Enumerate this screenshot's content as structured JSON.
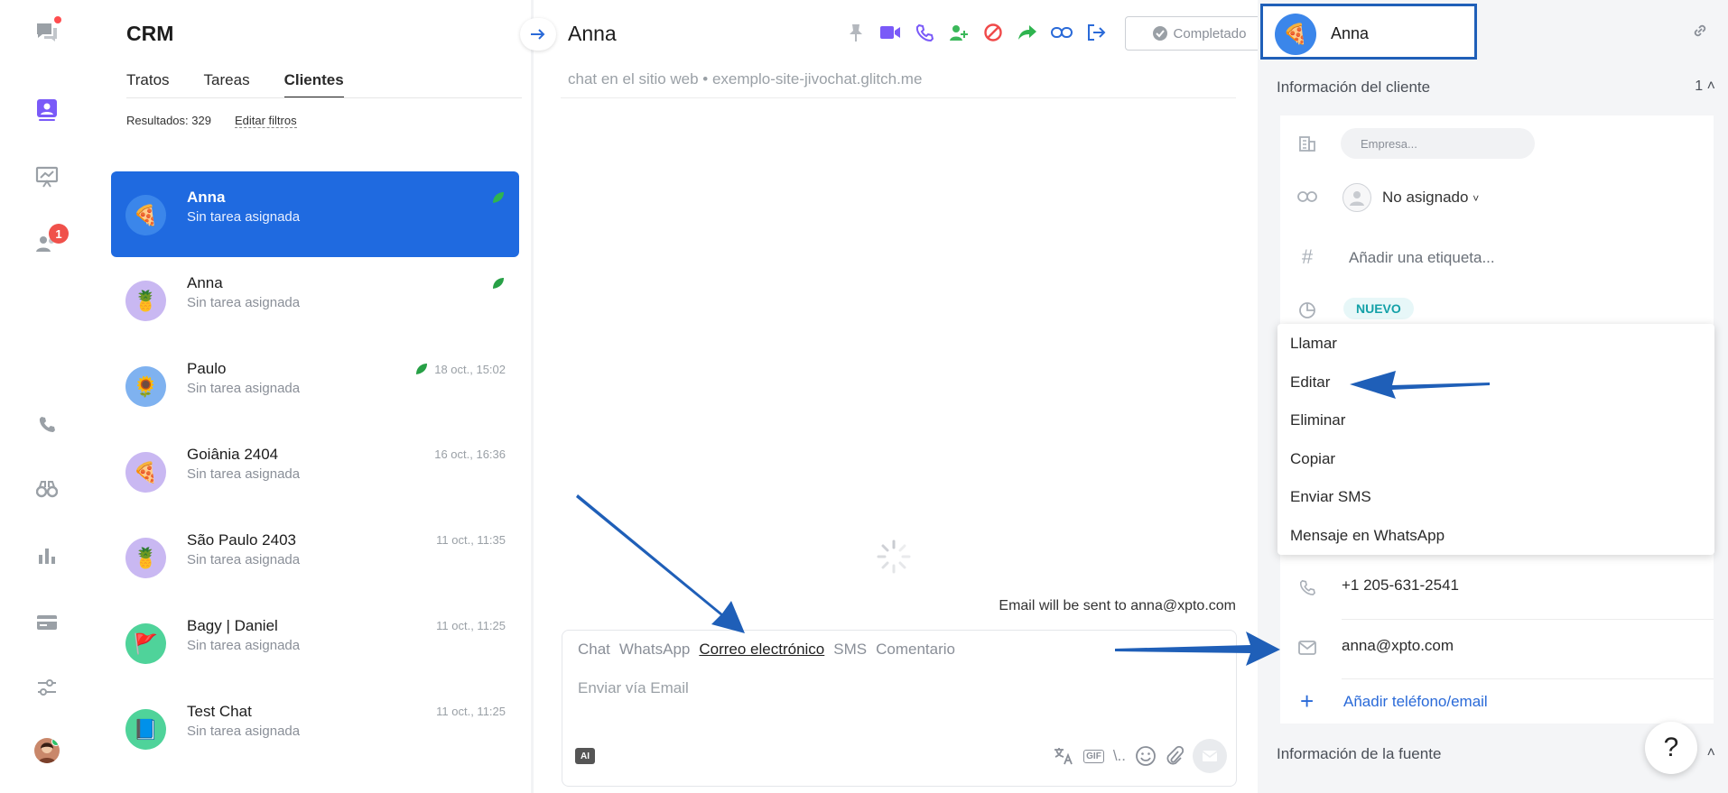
{
  "rail": {
    "chats_icon": "chat-bubbles-icon",
    "crm_icon": "contact-card-icon",
    "analytics_icon": "presentation-chart-icon",
    "team_icon": "team-icon",
    "team_badge": "1",
    "calls_icon": "phone-icon",
    "monitor_icon": "binoculars-icon",
    "reports_icon": "bar-chart-icon",
    "billing_icon": "card-icon",
    "settings_icon": "sliders-icon"
  },
  "crm": {
    "title": "CRM",
    "tabs": [
      "Tratos",
      "Tareas",
      "Clientes"
    ],
    "results_label": "Resultados: 329",
    "edit_filters": "Editar filtros",
    "items": [
      {
        "name": "Anna",
        "sub": "Sin tarea asignada",
        "time": "",
        "emoji": "🍕",
        "bg": "#3b86ea"
      },
      {
        "name": "Anna",
        "sub": "Sin tarea asignada",
        "time": "",
        "emoji": "🍍",
        "bg": "#c9b8f2"
      },
      {
        "name": "Paulo",
        "sub": "Sin tarea asignada",
        "time": "18 oct., 15:02",
        "emoji": "🌻",
        "bg": "#7fb2f0"
      },
      {
        "name": "Goiânia 2404",
        "sub": "Sin tarea asignada",
        "time": "16 oct., 16:36",
        "emoji": "🍕",
        "bg": "#c9b8f2"
      },
      {
        "name": "São Paulo 2403",
        "sub": "Sin tarea asignada",
        "time": "11 oct., 11:35",
        "emoji": "🍍",
        "bg": "#c9b8f2"
      },
      {
        "name": "Bagy | Daniel",
        "sub": "Sin tarea asignada",
        "time": "11 oct., 11:25",
        "emoji": "🚩",
        "bg": "#4fd39a"
      },
      {
        "name": "Test Chat",
        "sub": "Sin tarea asignada",
        "time": "11 oct., 11:25",
        "emoji": "📘",
        "bg": "#4fd39a"
      }
    ]
  },
  "chat": {
    "name": "Anna",
    "source": "chat en el sitio web • exemplo-site-jivochat.glitch.me",
    "done_label": "Completado",
    "email_note": "Email will be sent to anna@xpto.com",
    "compose_tabs": [
      "Chat",
      "WhatsApp",
      "Correo electrónico",
      "SMS",
      "Comentario"
    ],
    "compose_placeholder": "Enviar vía Email",
    "ai_label": "AI",
    "gif_label": "GIF",
    "slash_label": "\\.."
  },
  "right": {
    "contact_name": "Anna",
    "client_info_title": "Información del cliente",
    "client_info_count": "1",
    "company_placeholder": "Empresa...",
    "assignee": "No asignado",
    "tag_placeholder": "Añadir una etiqueta...",
    "status": "NUEVO",
    "menu": [
      "Llamar",
      "Editar",
      "Eliminar",
      "Copiar",
      "Enviar SMS",
      "Mensaje en WhatsApp"
    ],
    "phone": "+1 205-631-2541",
    "email": "anna@xpto.com",
    "add_contact": "Añadir teléfono/email",
    "source_info_title": "Información de la fuente",
    "help": "?"
  },
  "colors": {
    "accent": "#1f6ae0",
    "annotation_arrow": "#1f5fb8",
    "status_teal": "#14a1a8",
    "leaf_green": "#27a046"
  }
}
